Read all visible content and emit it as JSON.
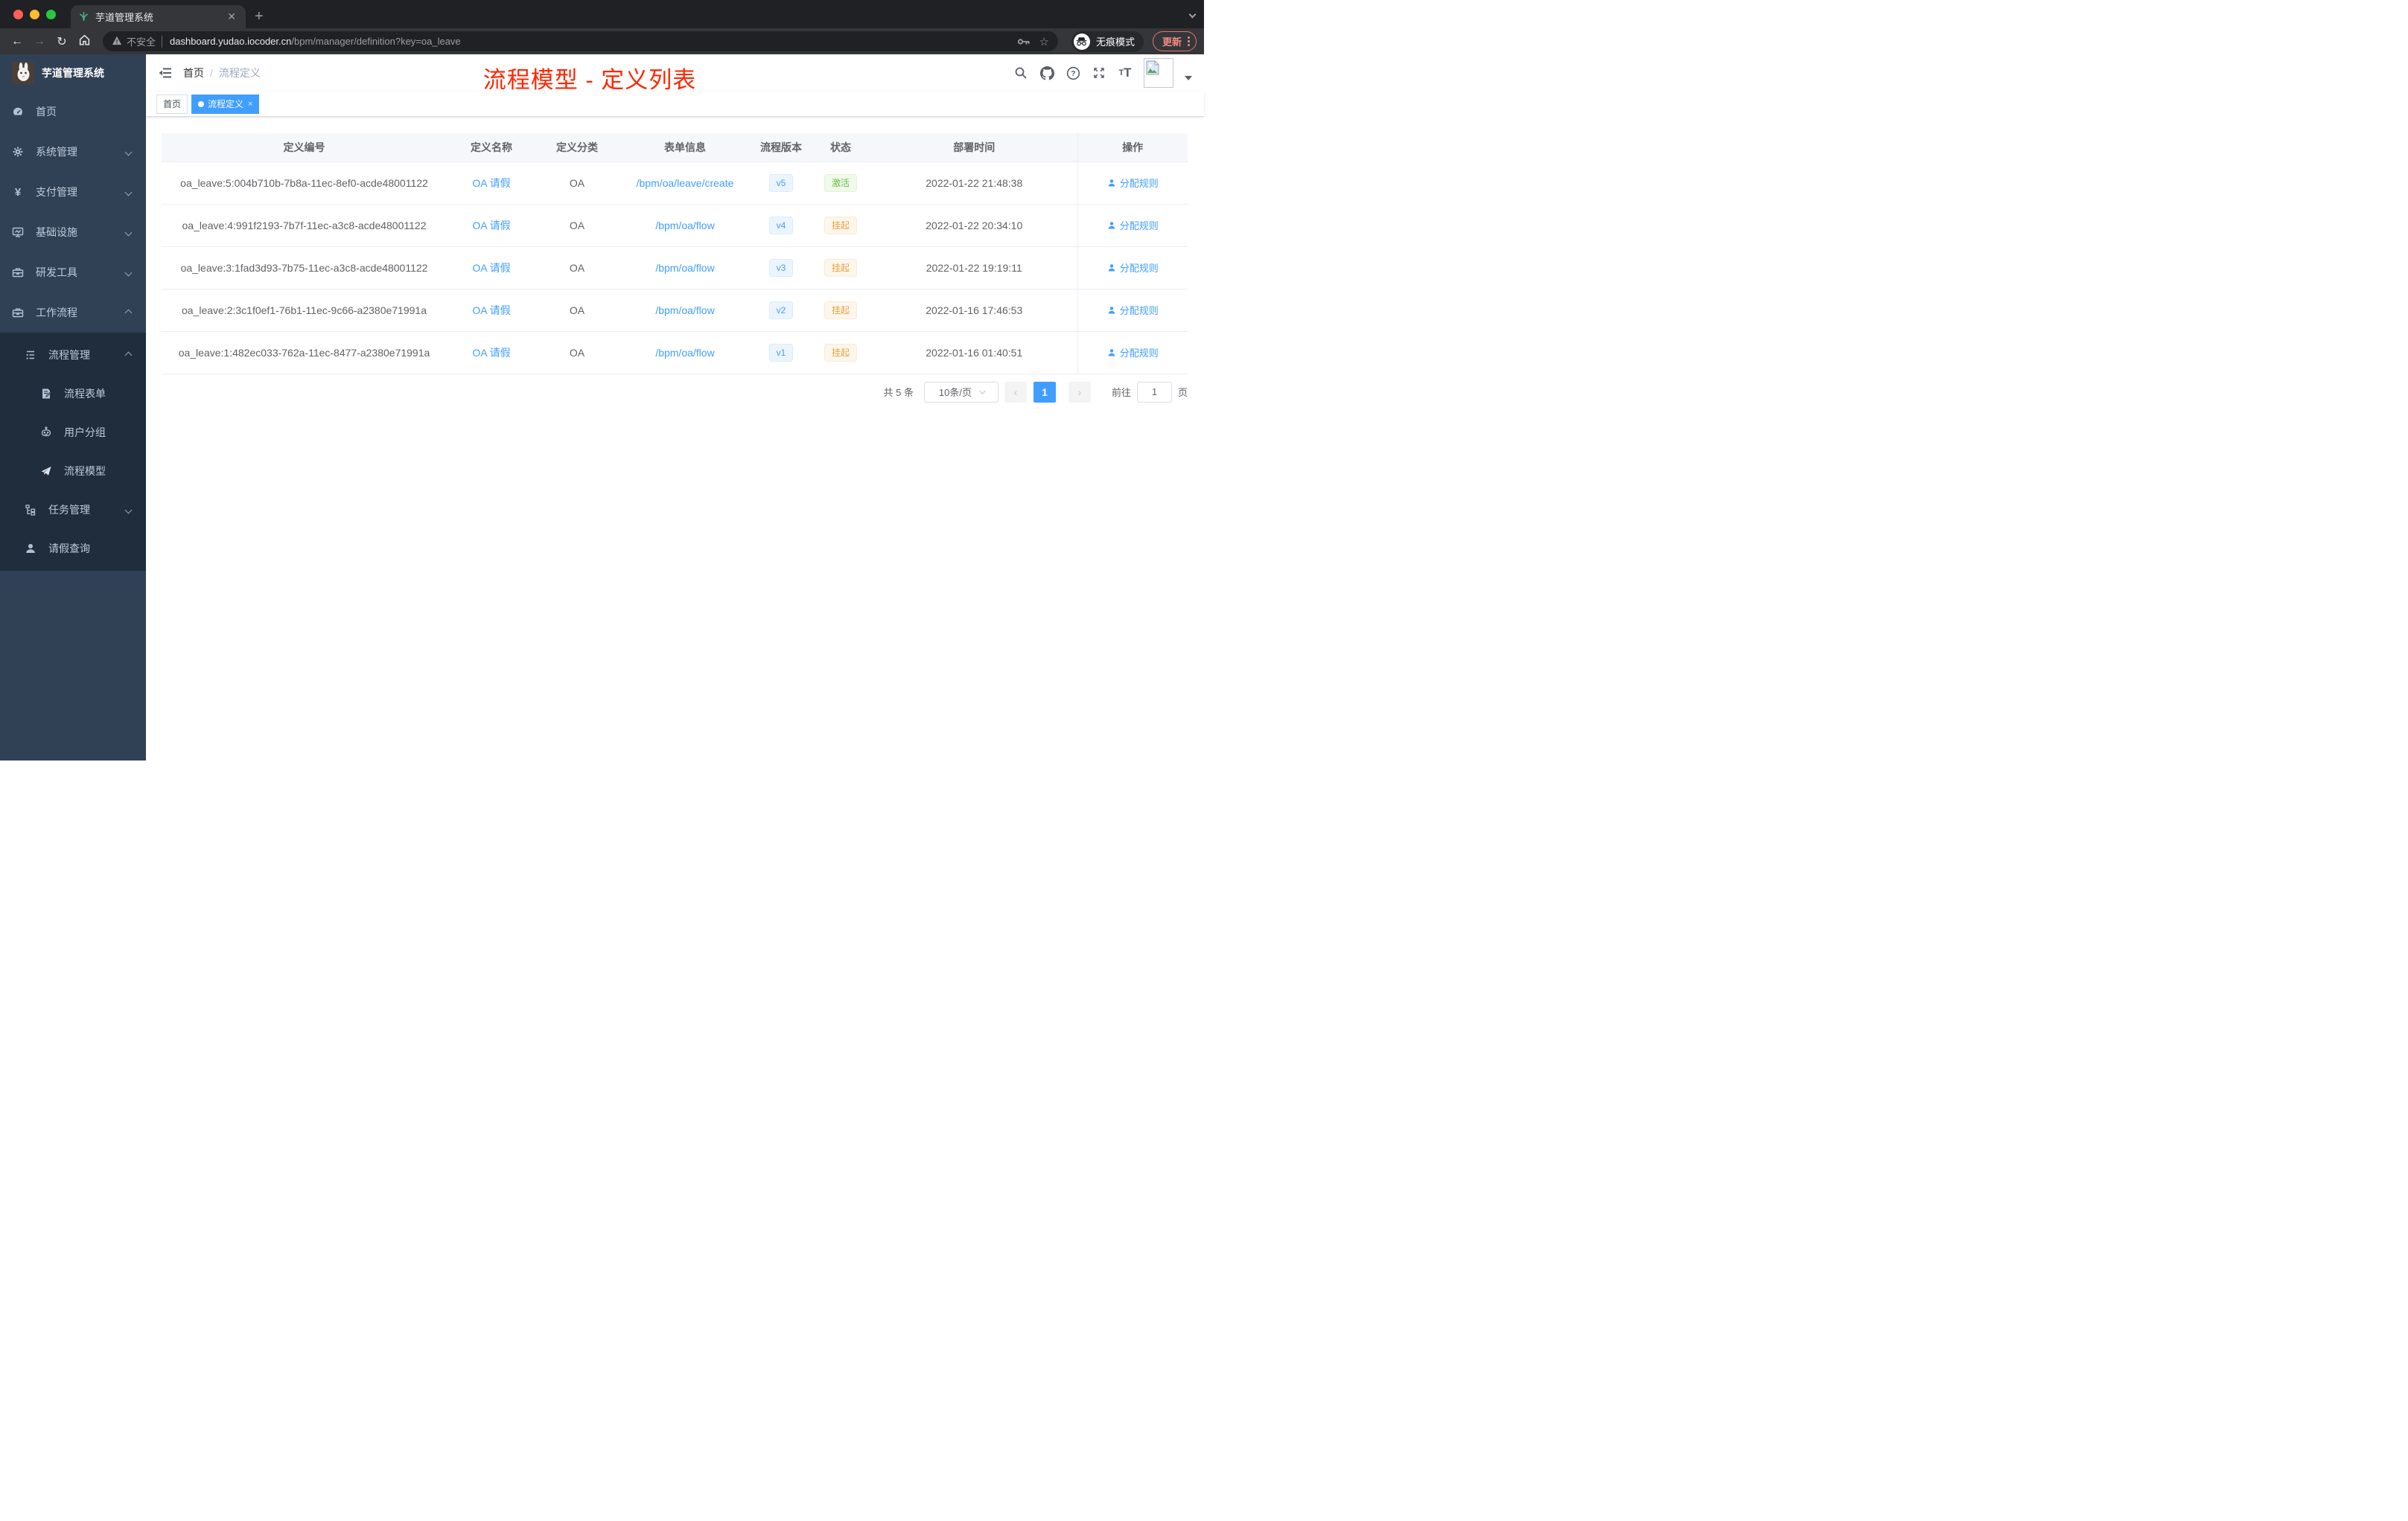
{
  "browser": {
    "tab_title": "芋道管理系统",
    "security_label": "不安全",
    "url_host": "dashboard.yudao.iocoder.cn",
    "url_path": "/bpm/manager/definition?key=oa_leave",
    "incognito_label": "无痕模式",
    "update_label": "更新"
  },
  "sidebar": {
    "logo_title": "芋道管理系统",
    "items": [
      {
        "label": "首页"
      },
      {
        "label": "系统管理"
      },
      {
        "label": "支付管理"
      },
      {
        "label": "基础设施"
      },
      {
        "label": "研发工具"
      },
      {
        "label": "工作流程"
      },
      {
        "label": "流程管理"
      },
      {
        "label": "流程表单"
      },
      {
        "label": "用户分组"
      },
      {
        "label": "流程模型"
      },
      {
        "label": "任务管理"
      },
      {
        "label": "请假查询"
      }
    ]
  },
  "navbar": {
    "breadcrumb_home": "首页",
    "breadcrumb_sep": "/",
    "breadcrumb_current": "流程定义"
  },
  "tags": {
    "home": "首页",
    "active": "流程定义",
    "close": "×"
  },
  "annotation": {
    "text": "流程模型 - 定义列表",
    "color": "#ff2600"
  },
  "table": {
    "columns": [
      "定义编号",
      "定义名称",
      "定义分类",
      "表单信息",
      "流程版本",
      "状态",
      "部署时间",
      "操作"
    ],
    "action_label": "分配规则",
    "rows": [
      {
        "id": "oa_leave:5:004b710b-7b8a-11ec-8ef0-acde48001122",
        "name": "OA 请假",
        "category": "OA",
        "form": "/bpm/oa/leave/create",
        "version": "v5",
        "status": "激活",
        "status_type": "success",
        "time": "2022-01-22 21:48:38"
      },
      {
        "id": "oa_leave:4:991f2193-7b7f-11ec-a3c8-acde48001122",
        "name": "OA 请假",
        "category": "OA",
        "form": "/bpm/oa/flow",
        "version": "v4",
        "status": "挂起",
        "status_type": "warning",
        "time": "2022-01-22 20:34:10"
      },
      {
        "id": "oa_leave:3:1fad3d93-7b75-11ec-a3c8-acde48001122",
        "name": "OA 请假",
        "category": "OA",
        "form": "/bpm/oa/flow",
        "version": "v3",
        "status": "挂起",
        "status_type": "warning",
        "time": "2022-01-22 19:19:11"
      },
      {
        "id": "oa_leave:2:3c1f0ef1-76b1-11ec-9c66-a2380e71991a",
        "name": "OA 请假",
        "category": "OA",
        "form": "/bpm/oa/flow",
        "version": "v2",
        "status": "挂起",
        "status_type": "warning",
        "time": "2022-01-16 17:46:53"
      },
      {
        "id": "oa_leave:1:482ec033-762a-11ec-8477-a2380e71991a",
        "name": "OA 请假",
        "category": "OA",
        "form": "/bpm/oa/flow",
        "version": "v1",
        "status": "挂起",
        "status_type": "warning",
        "time": "2022-01-16 01:40:51"
      }
    ]
  },
  "pagination": {
    "total": "共 5 条",
    "page_size": "10条/页",
    "prev": "‹",
    "page": "1",
    "next": "›",
    "goto": "前往",
    "unit": "页"
  },
  "colors": {
    "accent": "#409eff",
    "sidebar_bg": "#304156",
    "submenu_bg": "#1f2d3d",
    "success": "#67c23a",
    "warning": "#e6a23c",
    "annotation_red": "#ff2600"
  }
}
